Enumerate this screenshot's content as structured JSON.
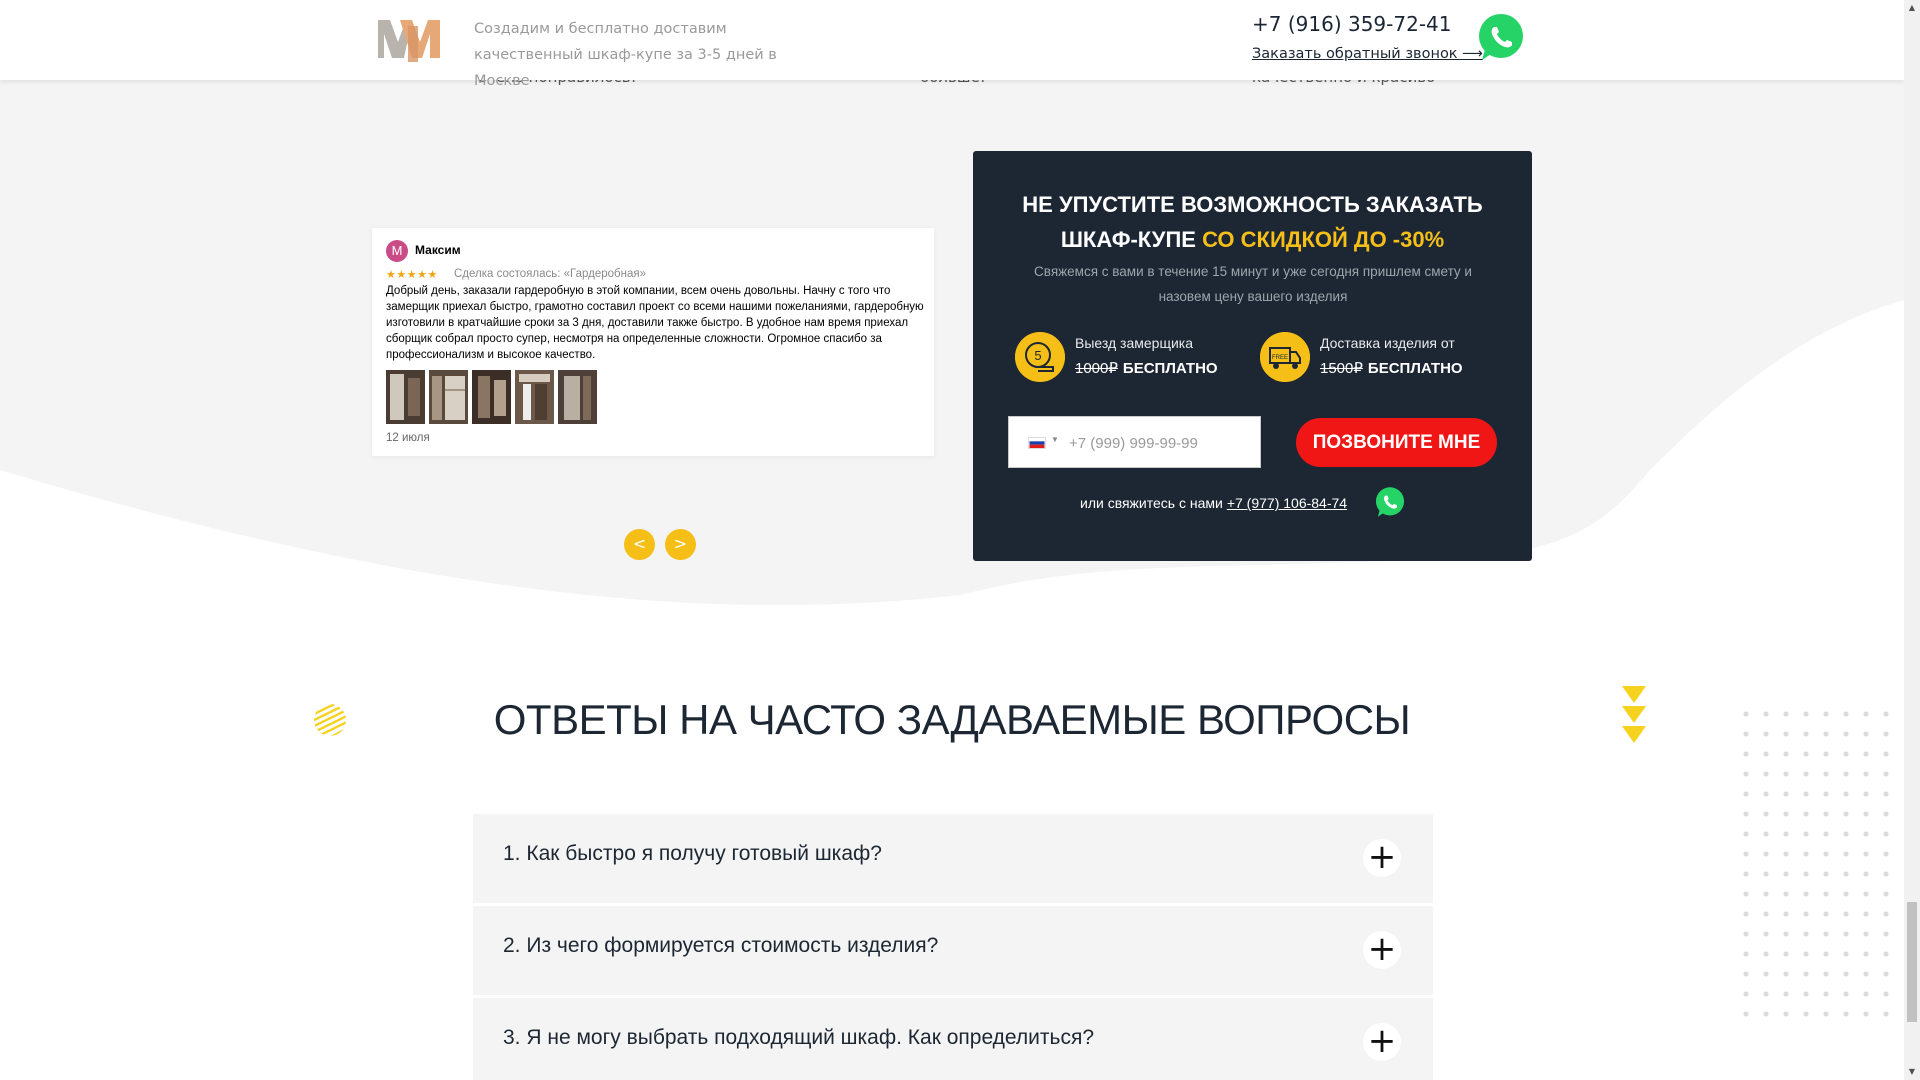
{
  "header": {
    "tagline": "Создадим и бесплатно доставим качественный шкаф-купе за 3-5 дней в Москве",
    "phone": "+7 (916) 359-72-41",
    "callback_link": "Заказать обратный звонок ⟶",
    "whatsapp_icon": "whatsapp-icon"
  },
  "snippets": [
    "очень понравилось!",
    "больше!",
    "качественно и красиво\""
  ],
  "review": {
    "avatar_letter": "М",
    "author": "Максим",
    "stars": "★★★★★",
    "deal": "Сделка состоялась: «Гардеробная»",
    "text": "Добрый день, заказали гардеробную в этой компании, всем очень довольны. Начну с того что замерщик приехал быстро, грамотно составил проект со всеми нашими пожеланиями, гардеробную изготовили в кратчайшие сроки за 3 дня, доставили также быстро. В удобное нам время приехал сборщик собрал просто супер, несмотря на определенные сложности. Огромное спасибо за профессионализм и высокое качество.",
    "photo_count": 5,
    "date": "12 июля",
    "prev": "<",
    "next": ">"
  },
  "promo": {
    "title_line1": "НЕ УПУСТИТЕ ВОЗМОЖНОСТЬ ЗАКАЗАТЬ",
    "title_line2_prefix": "ШКАФ-КУПЕ ",
    "title_line2_accent": "СО СКИДКОЙ ДО -30%",
    "subtitle": "Свяжемся с вами в течение 15 минут и уже сегодня пришлем смету и назовем цену вашего изделия",
    "features": [
      {
        "label": "Выезд замерщика",
        "old_price": "1000₽",
        "new_price": "БЕСПЛАТНО",
        "icon": "tape-measure-icon"
      },
      {
        "label": "Доставка изделия от",
        "old_price": "1500₽",
        "new_price": "БЕСПЛАТНО",
        "icon": "delivery-truck-icon"
      }
    ],
    "phone_placeholder": "+7 (999) 999-99-99",
    "phone_value": "",
    "call_button": "ПОЗВОНИТЕ МНЕ",
    "contact_prefix": "или свяжитесь с нами",
    "contact_phone": "+7 (977) 106-84-74"
  },
  "faq": {
    "title": "ОТВЕТЫ НА ЧАСТО ЗАДАВАЕМЫЕ ВОПРОСЫ",
    "items": [
      {
        "question": "1. Как быстро я получу готовый шкаф?"
      },
      {
        "question": "2. Из чего формируется стоимость изделия?"
      },
      {
        "question": "3. Я не могу выбрать подходящий шкаф. Как определиться?"
      }
    ]
  },
  "colors": {
    "accent": "#f5bf18",
    "dark_panel": "#1c2733",
    "cta_red": "#f01616",
    "whatsapp": "#25d366"
  }
}
